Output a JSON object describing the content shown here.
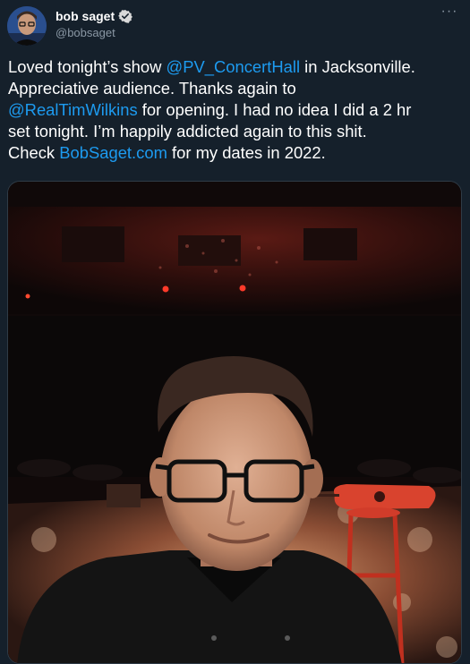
{
  "tweet": {
    "author": {
      "display_name": "bob saget",
      "handle": "@bobsaget",
      "verified": true,
      "avatar_icon": "user-avatar-photo",
      "verified_icon": "verified-badge-icon"
    },
    "more_icon": "more-options-icon",
    "text": {
      "line1": {
        "before": "Loved tonight’s show ",
        "link": "@PV_ConcertHall",
        "after": " in Jacksonville."
      },
      "line2": "Appreciative audience. Thanks again to",
      "line3": {
        "link": "@RealTimWilkins",
        "after": " for opening. I had no idea I did a 2 hr"
      },
      "line4": "set tonight. I’m happily addicted again to this shit.",
      "line5": {
        "before": "Check ",
        "link": "BobSaget.com",
        "after": " for my dates in 2022."
      }
    },
    "media": {
      "type": "photo"
    }
  },
  "colors": {
    "background": "#15202b",
    "link": "#1d9bf0",
    "secondary_text": "#8b98a5",
    "verified": "#d9d9d9"
  }
}
